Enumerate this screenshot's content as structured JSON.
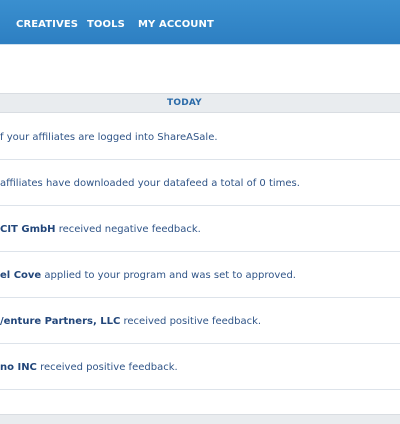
{
  "nav": {
    "creatives": "CREATIVES",
    "tools": "TOOLS",
    "my_account": "MY ACCOUNT"
  },
  "section": {
    "heading": "TODAY"
  },
  "feed": [
    {
      "strong": "",
      "text": "f your affiliates are logged into ShareASale."
    },
    {
      "strong": "",
      "text": "affiliates have downloaded your datafeed a total of 0 times."
    },
    {
      "strong": "CIT GmbH",
      "text": " received negative feedback."
    },
    {
      "strong": "el Cove",
      "text": " applied to your program and was set to approved."
    },
    {
      "strong": "/enture Partners, LLC",
      "text": " received positive feedback."
    },
    {
      "strong": "no INC",
      "text": " received positive feedback."
    }
  ]
}
